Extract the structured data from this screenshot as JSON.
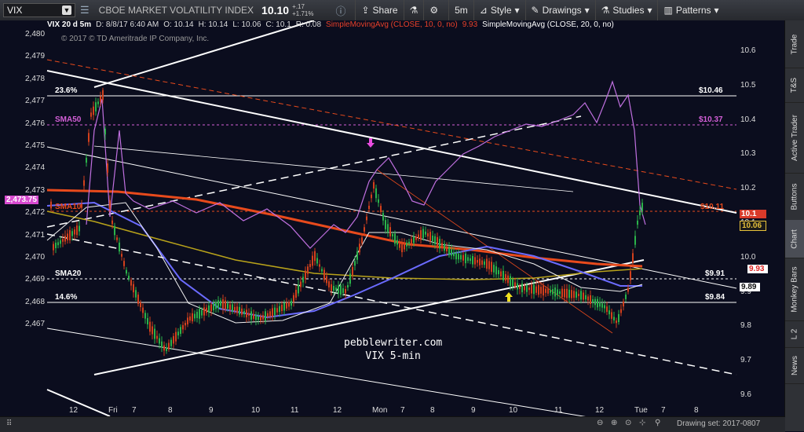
{
  "toolbar": {
    "symbol": "VIX",
    "description": "CBOE MARKET VOLATILITY INDEX",
    "last": "10.10",
    "change_abs": "+.17",
    "change_pct": "+1.71%",
    "share": "Share",
    "timeframe": "5m",
    "style": "Style",
    "drawings": "Drawings",
    "studies": "Studies",
    "patterns": "Patterns"
  },
  "info": {
    "symbol": "VIX 20 d 5m",
    "date": "D: 8/8/17 6:40 AM",
    "open": "O: 10.14",
    "high": "H: 10.14",
    "low": "L: 10.06",
    "close": "C: 10.1",
    "range": "R: 0.08",
    "sma10": "SimpleMovingAvg (CLOSE, 10, 0, no)",
    "sma10_val": "9.93",
    "sma20": "SimpleMovingAvg (CLOSE, 20, 0, no)"
  },
  "copyright": "© 2017 © TD Ameritrade IP Company, Inc.",
  "left_axis": [
    "2,480",
    "2,479",
    "2,478",
    "2,477",
    "2,476",
    "2,475",
    "2,474",
    "2,473",
    "2,472",
    "2,471",
    "2,470",
    "2,469",
    "2,468",
    "2,467"
  ],
  "left_price_label": "2,473.75",
  "right_axis": [
    "10.6",
    "10.5",
    "10.4",
    "10.3",
    "10.2",
    "10.1",
    "10.0",
    "9.9",
    "9.8",
    "9.7",
    "9.6"
  ],
  "x_axis": [
    "12",
    "Fri",
    "7",
    "8",
    "9",
    "10",
    "11",
    "12",
    "Mon",
    "7",
    "8",
    "9",
    "10",
    "11",
    "12",
    "Tue",
    "7",
    "8"
  ],
  "levels": {
    "fib_top_label": "23.6%",
    "fib_top_value": "$10.46",
    "sma50_label": "SMA50",
    "sma50_value": "$10.37",
    "sma10_label": "SMA10",
    "sma10_value": "$10.11",
    "sma20_label": "SMA20",
    "sma20_value": "$9.91",
    "fib_bottom_label": "14.6%",
    "fib_bottom_value": "$9.84"
  },
  "price_labels": {
    "last": "10.1",
    "close": "10.06",
    "sma10": "9.93",
    "sma20": "9.89"
  },
  "watermark": {
    "line1": "pebblewriter.com",
    "line2": "VIX 5-min"
  },
  "sidebar_tabs": [
    "Trade",
    "T&S",
    "Active Trader",
    "Buttons",
    "Chart",
    "Monkey Bars",
    "L 2",
    "News"
  ],
  "bottom": {
    "drawing_set": "Drawing set: 2017-0807"
  },
  "colors": {
    "bg": "#0b0d1e",
    "sma200": "#e84a1c",
    "sma50_sp": "#b8a21a",
    "blue": "#6b6bff",
    "vix": "#c070e0",
    "green": "#2bb24a",
    "red": "#d2401c"
  }
}
